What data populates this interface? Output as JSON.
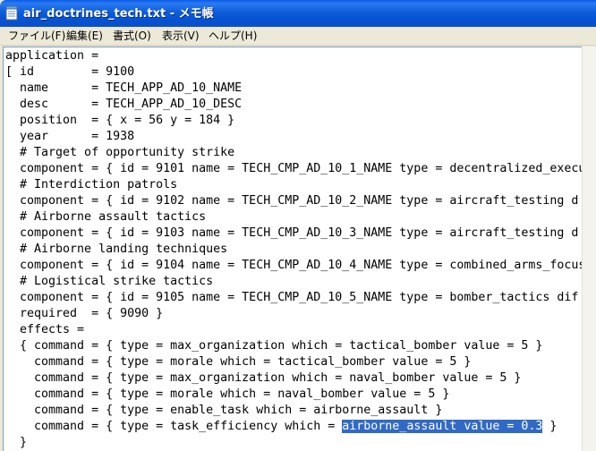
{
  "window": {
    "title": "air_doctrines_tech.txt - メモ帳",
    "icon": "notepad-icon"
  },
  "menu": [
    {
      "label": "ファイル(F)"
    },
    {
      "label": "編集(E)"
    },
    {
      "label": "書式(O)"
    },
    {
      "label": "表示(V)"
    },
    {
      "label": "ヘルプ(H)"
    }
  ],
  "editor": {
    "lines": [
      "application =",
      "[ id        = 9100",
      "  name      = TECH_APP_AD_10_NAME",
      "  desc      = TECH_APP_AD_10_DESC",
      "  position  = { x = 56 y = 184 }",
      "  year      = 1938",
      "  # Target of opportunity strike",
      "  component = { id = 9101 name = TECH_CMP_AD_10_1_NAME type = decentralized_execu",
      "  # Interdiction patrols",
      "  component = { id = 9102 name = TECH_CMP_AD_10_2_NAME type = aircraft_testing d",
      "  # Airborne assault tactics",
      "  component = { id = 9103 name = TECH_CMP_AD_10_3_NAME type = aircraft_testing d",
      "  # Airborne landing techniques",
      "  component = { id = 9104 name = TECH_CMP_AD_10_4_NAME type = combined_arms_focus",
      "  # Logistical strike tactics",
      "  component = { id = 9105 name = TECH_CMP_AD_10_5_NAME type = bomber_tactics dif",
      "  required  = { 9090 }",
      "  effects =",
      "  { command = { type = max_organization which = tactical_bomber value = 5 }",
      "    command = { type = morale which = tactical_bomber value = 5 }",
      "    command = { type = max_organization which = naval_bomber value = 5 }",
      "    command = { type = morale which = naval_bomber value = 5 }",
      "    command = { type = enable_task which = airborne_assault }",
      "    command = { type = task_efficiency which = ",
      "  }"
    ],
    "selected_text": "airborne_assault value = 0.3",
    "after_selection": " }",
    "selection_color": "#316ac5"
  }
}
